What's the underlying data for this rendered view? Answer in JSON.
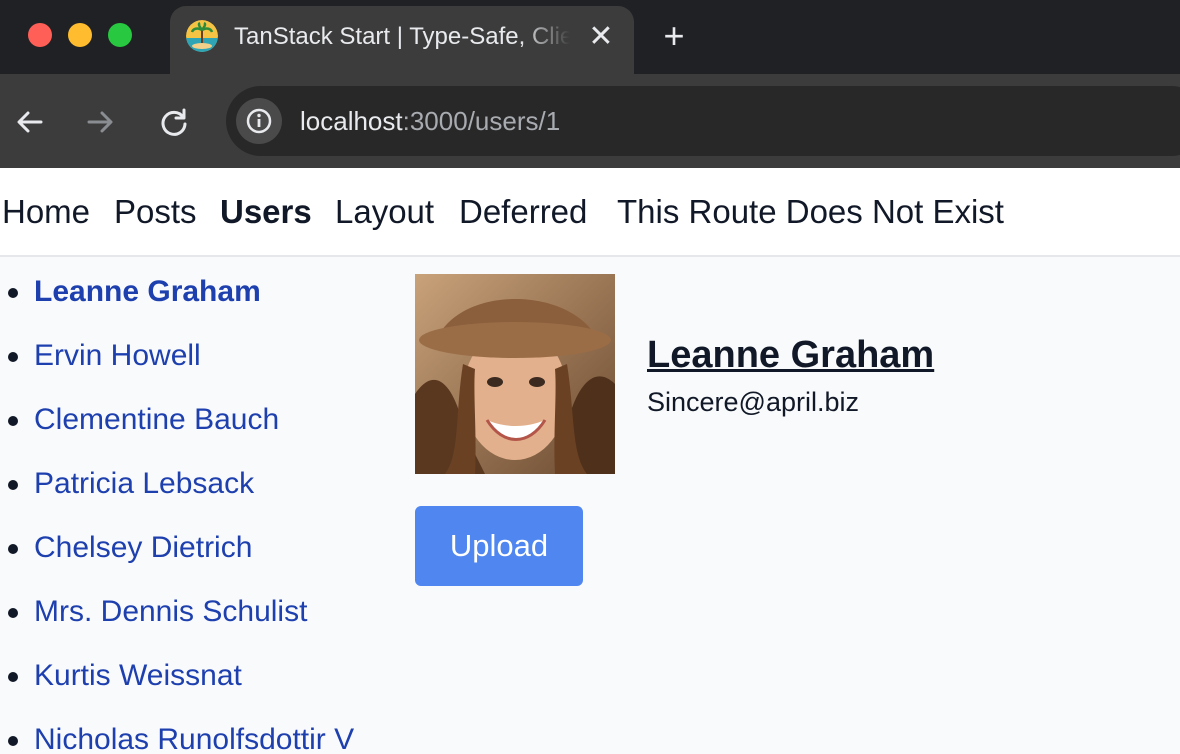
{
  "window": {
    "tab_title": "TanStack Start | Type-Safe, Client-First, Full-Stack React Framework",
    "tab_close_icon": "close-icon",
    "new_tab_icon": "plus-icon",
    "new_tab_label": "+",
    "close_label": "✕"
  },
  "toolbar": {
    "url_host": "localhost",
    "url_rest": ":3000/users/1"
  },
  "nav": {
    "links": [
      {
        "label": "Home",
        "active": false
      },
      {
        "label": "Posts",
        "active": false
      },
      {
        "label": "Users",
        "active": true
      },
      {
        "label": "Layout",
        "active": false
      },
      {
        "label": "Deferred",
        "active": false
      },
      {
        "label": "This Route Does Not Exist",
        "active": false
      }
    ]
  },
  "users": [
    {
      "name": "Leanne Graham",
      "active": true
    },
    {
      "name": "Ervin Howell",
      "active": false
    },
    {
      "name": "Clementine Bauch",
      "active": false
    },
    {
      "name": "Patricia Lebsack",
      "active": false
    },
    {
      "name": "Chelsey Dietrich",
      "active": false
    },
    {
      "name": "Mrs. Dennis Schulist",
      "active": false
    },
    {
      "name": "Kurtis Weissnat",
      "active": false
    },
    {
      "name": "Nicholas Runolfsdottir V",
      "active": false
    }
  ],
  "profile": {
    "name": "Leanne Graham",
    "email": "Sincere@april.biz",
    "upload_label": "Upload"
  },
  "colors": {
    "link": "#1e40af",
    "button": "#4f86f0"
  }
}
